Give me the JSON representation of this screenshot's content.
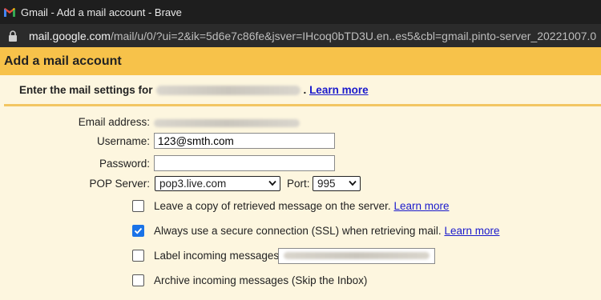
{
  "browser": {
    "window_title": "Gmail - Add a mail account - Brave",
    "url_domain": "mail.google.com",
    "url_path": "/mail/u/0/?ui=2&ik=5d6e7c86fe&jsver=IHcoq0bTD3U.en..es5&cbl=gmail.pinto-server_20221007.0"
  },
  "dialog": {
    "title": "Add a mail account",
    "intro_text": "Enter the mail settings for",
    "intro_suffix": ".",
    "learn_more": "Learn more"
  },
  "form": {
    "email_label": "Email address:",
    "username_label": "Username:",
    "username_value": "123@smth.com",
    "password_label": "Password:",
    "password_value": "",
    "pop_server_label": "POP Server:",
    "pop_server_value": "pop3.live.com",
    "port_label": "Port:",
    "port_value": "995"
  },
  "options": {
    "leave_copy": {
      "text": "Leave a copy of retrieved message on the server.",
      "link": "Learn more",
      "checked": false
    },
    "ssl": {
      "text": "Always use a secure connection (SSL) when retrieving mail.",
      "link": "Learn more",
      "checked": true
    },
    "label_incoming": {
      "text": "Label incoming messages:",
      "checked": false
    },
    "archive": {
      "text": "Archive incoming messages (Skip the Inbox)",
      "checked": false
    }
  },
  "colors": {
    "header_bg": "#f7c24a",
    "page_bg": "#fdf6df",
    "checkbox_checked": "#1a73e8",
    "link": "#1a1acc"
  }
}
